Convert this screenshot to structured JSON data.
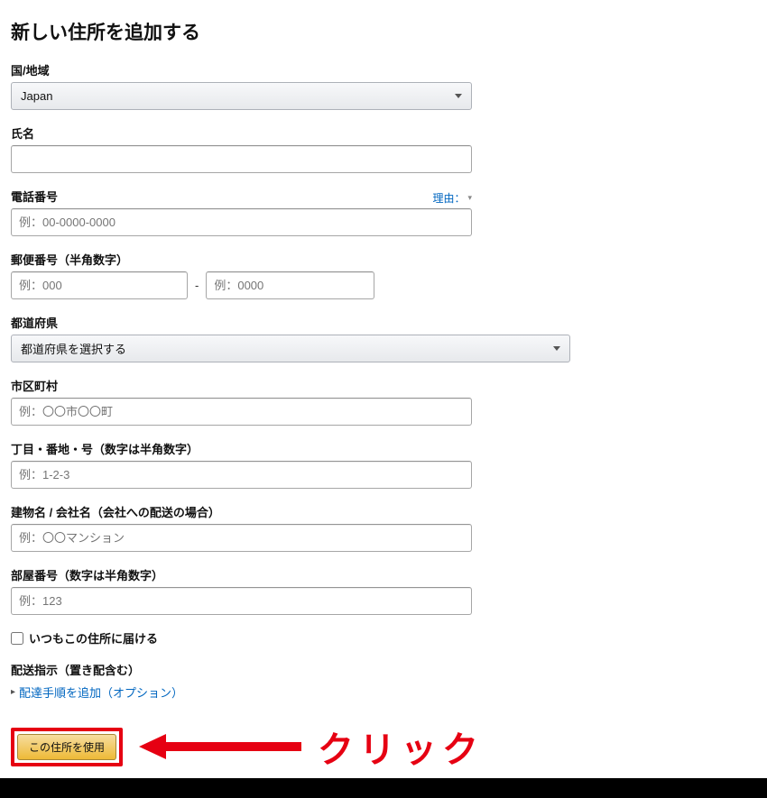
{
  "page": {
    "title": "新しい住所を追加する"
  },
  "country": {
    "label": "国/地域",
    "value": "Japan"
  },
  "fullname": {
    "label": "氏名",
    "value": ""
  },
  "phone": {
    "label": "電話番号",
    "hint": "理由：",
    "placeholder": "例：00-0000-0000",
    "value": ""
  },
  "postal": {
    "label": "郵便番号（半角数字）",
    "p1_placeholder": "例：000",
    "p2_placeholder": "例：0000",
    "p1": "",
    "p2": ""
  },
  "prefecture": {
    "label": "都道府県",
    "value": "都道府県を選択する"
  },
  "city": {
    "label": "市区町村",
    "placeholder": "例：〇〇市〇〇町",
    "value": ""
  },
  "street": {
    "label": "丁目・番地・号（数字は半角数字）",
    "placeholder": "例：1-2-3",
    "value": ""
  },
  "building": {
    "label": "建物名 / 会社名（会社への配送の場合）",
    "placeholder": "例：〇〇マンション",
    "value": ""
  },
  "room": {
    "label": "部屋番号（数字は半角数字）",
    "placeholder": "例：123",
    "value": ""
  },
  "default_addr": {
    "label": "いつもこの住所に届ける"
  },
  "delivery": {
    "label": "配送指示（置き配含む）",
    "link": "配達手順を追加（オプション）"
  },
  "submit": {
    "label": "この住所を使用"
  },
  "annotation": {
    "click": "クリック"
  },
  "colors": {
    "accent_red": "#e60012",
    "link_blue": "#0066c0"
  }
}
